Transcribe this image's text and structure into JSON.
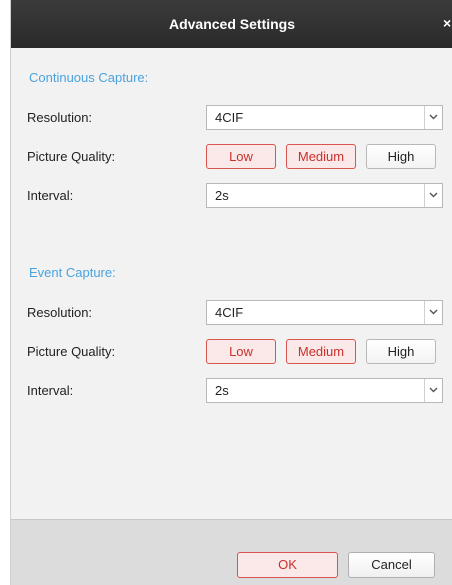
{
  "dialog": {
    "title": "Advanced Settings",
    "close_glyph": "×"
  },
  "continuous": {
    "section_title": "Continuous Capture:",
    "resolution_label": "Resolution:",
    "resolution_value": "4CIF",
    "quality_label": "Picture Quality:",
    "quality_options": [
      "Low",
      "Medium",
      "High"
    ],
    "quality_highlighted": [
      "Low",
      "Medium"
    ],
    "interval_label": "Interval:",
    "interval_value": "2s"
  },
  "event": {
    "section_title": "Event Capture:",
    "resolution_label": "Resolution:",
    "resolution_value": "4CIF",
    "quality_label": "Picture Quality:",
    "quality_options": [
      "Low",
      "Medium",
      "High"
    ],
    "quality_highlighted": [
      "Low",
      "Medium"
    ],
    "interval_label": "Interval:",
    "interval_value": "2s"
  },
  "footer": {
    "ok_label": "OK",
    "cancel_label": "Cancel"
  },
  "colors": {
    "section_title": "#4aa3df",
    "selected_border": "#d9534f",
    "titlebar": "#2f2f2f"
  },
  "icons": {
    "dropdown": "chevron-down-icon",
    "close": "close-icon"
  }
}
